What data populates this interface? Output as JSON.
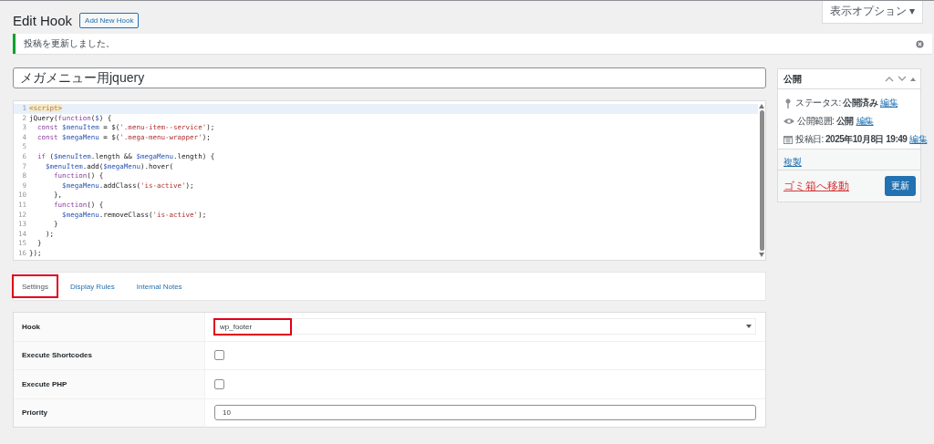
{
  "screen_options": {
    "label": "表示オプション ▾"
  },
  "page_title": "Edit Hook",
  "add_new_button": "Add New Hook",
  "notice": {
    "text": "投稿を更新しました。"
  },
  "post_title": {
    "value": "メガメニュー用jquery"
  },
  "editor": {
    "lines": [
      {
        "number": "1",
        "active": true,
        "tokens": [
          {
            "kind": "tag",
            "text": "<script>"
          }
        ]
      },
      {
        "number": "2",
        "active": false,
        "tokens": [
          {
            "kind": "plain",
            "text": "jQuery("
          },
          {
            "kind": "keyword",
            "text": "function"
          },
          {
            "kind": "plain",
            "text": "("
          },
          {
            "kind": "variable",
            "text": "$"
          },
          {
            "kind": "plain",
            "text": ") {"
          }
        ]
      },
      {
        "number": "3",
        "active": false,
        "tokens": [
          {
            "kind": "keyword",
            "text": "  const"
          },
          {
            "kind": "variable",
            "text": " $menuItem"
          },
          {
            "kind": "plain",
            "text": " = $("
          },
          {
            "kind": "string",
            "text": "'.menu-item--service'"
          },
          {
            "kind": "plain",
            "text": ");"
          }
        ]
      },
      {
        "number": "4",
        "active": false,
        "tokens": [
          {
            "kind": "keyword",
            "text": "  const"
          },
          {
            "kind": "variable",
            "text": " $megaMenu"
          },
          {
            "kind": "plain",
            "text": " = $("
          },
          {
            "kind": "string",
            "text": "'.mega-menu-wrapper'"
          },
          {
            "kind": "plain",
            "text": ");"
          }
        ]
      },
      {
        "number": "5",
        "active": false
      },
      {
        "number": "6",
        "active": false,
        "tokens": [
          {
            "kind": "keyword",
            "text": "  if"
          },
          {
            "kind": "plain",
            "text": " ("
          },
          {
            "kind": "variable",
            "text": "$menuItem"
          },
          {
            "kind": "plain",
            "text": ".length && "
          },
          {
            "kind": "variable",
            "text": "$megaMenu"
          },
          {
            "kind": "plain",
            "text": ".length) {"
          }
        ]
      },
      {
        "number": "7",
        "active": false,
        "tokens": [
          {
            "kind": "variable",
            "text": "    $menuItem"
          },
          {
            "kind": "plain",
            "text": ".add("
          },
          {
            "kind": "variable",
            "text": "$megaMenu"
          },
          {
            "kind": "plain",
            "text": ").hover("
          }
        ]
      },
      {
        "number": "8",
        "active": false,
        "tokens": [
          {
            "kind": "keyword",
            "text": "      function"
          },
          {
            "kind": "plain",
            "text": "() {"
          }
        ]
      },
      {
        "number": "9",
        "active": false,
        "tokens": [
          {
            "kind": "variable",
            "text": "        $megaMenu"
          },
          {
            "kind": "plain",
            "text": ".addClass("
          },
          {
            "kind": "string",
            "text": "'is-active'"
          },
          {
            "kind": "plain",
            "text": ");"
          }
        ]
      },
      {
        "number": "10",
        "active": false,
        "tokens": [
          {
            "kind": "plain",
            "text": "      },"
          }
        ]
      },
      {
        "number": "11",
        "active": false,
        "tokens": [
          {
            "kind": "keyword",
            "text": "      function"
          },
          {
            "kind": "plain",
            "text": "() {"
          }
        ]
      },
      {
        "number": "12",
        "active": false,
        "tokens": [
          {
            "kind": "variable",
            "text": "        $megaMenu"
          },
          {
            "kind": "plain",
            "text": ".removeClass("
          },
          {
            "kind": "string",
            "text": "'is-active'"
          },
          {
            "kind": "plain",
            "text": ");"
          }
        ]
      },
      {
        "number": "13",
        "active": false,
        "tokens": [
          {
            "kind": "plain",
            "text": "      }"
          }
        ]
      },
      {
        "number": "14",
        "active": false,
        "tokens": [
          {
            "kind": "plain",
            "text": "    );"
          }
        ]
      },
      {
        "number": "15",
        "active": false,
        "tokens": [
          {
            "kind": "plain",
            "text": "  }"
          }
        ]
      },
      {
        "number": "16",
        "active": false,
        "tokens": [
          {
            "kind": "plain",
            "text": "});"
          }
        ]
      }
    ]
  },
  "tabs": [
    {
      "label": "Settings",
      "selected": true,
      "highlighted": true
    },
    {
      "label": "Display Rules",
      "selected": false,
      "highlighted": false
    },
    {
      "label": "Internal Notes",
      "selected": false,
      "highlighted": false
    }
  ],
  "settings": [
    {
      "kind": "select",
      "label": "Hook",
      "value": "wp_footer",
      "highlighted": true
    },
    {
      "kind": "checkbox",
      "label": "Execute Shortcodes",
      "checked": false
    },
    {
      "kind": "checkbox",
      "label": "Execute PHP",
      "checked": false
    },
    {
      "kind": "number",
      "label": "Priority",
      "value": "10"
    }
  ],
  "publish_box": {
    "title": "公開",
    "rows": [
      {
        "kind": "status",
        "text": "ステータス: **公開済み**",
        "link": "編集"
      },
      {
        "kind": "visibility",
        "text": "公開範囲: **公開**",
        "link": "編集"
      },
      {
        "kind": "date",
        "text": "投稿日: **2025年10月8日 19:49**",
        "link": "編集"
      }
    ],
    "duplicate_link": "複製",
    "trash_link": "ゴミ箱へ移動",
    "update_button": "更新"
  }
}
